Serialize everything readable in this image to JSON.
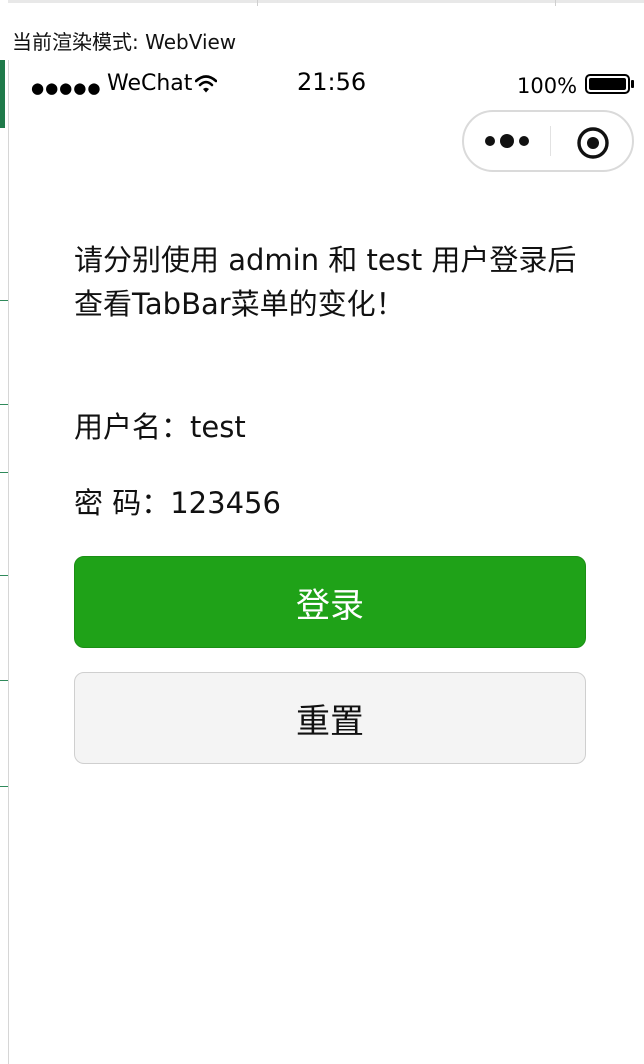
{
  "devtools": {
    "render_mode_label": "当前渲染模式: WebView"
  },
  "status_bar": {
    "signal_dots": "●●●●●",
    "carrier": "WeChat",
    "time": "21:56",
    "battery_percent": "100%"
  },
  "capsule": {
    "more_icon": "more-dots-icon",
    "close_icon": "target-circle-icon"
  },
  "page": {
    "notice": "请分别使用 admin 和 test 用户登录后查看TabBar菜单的变化！",
    "username_field": "用户名：test",
    "password_field": "密  码：123456",
    "login_button": "登录",
    "reset_button": "重置"
  },
  "colors": {
    "primary_button": "#1fa218",
    "secondary_button": "#f4f4f4",
    "capsule_border": "#dadada"
  }
}
